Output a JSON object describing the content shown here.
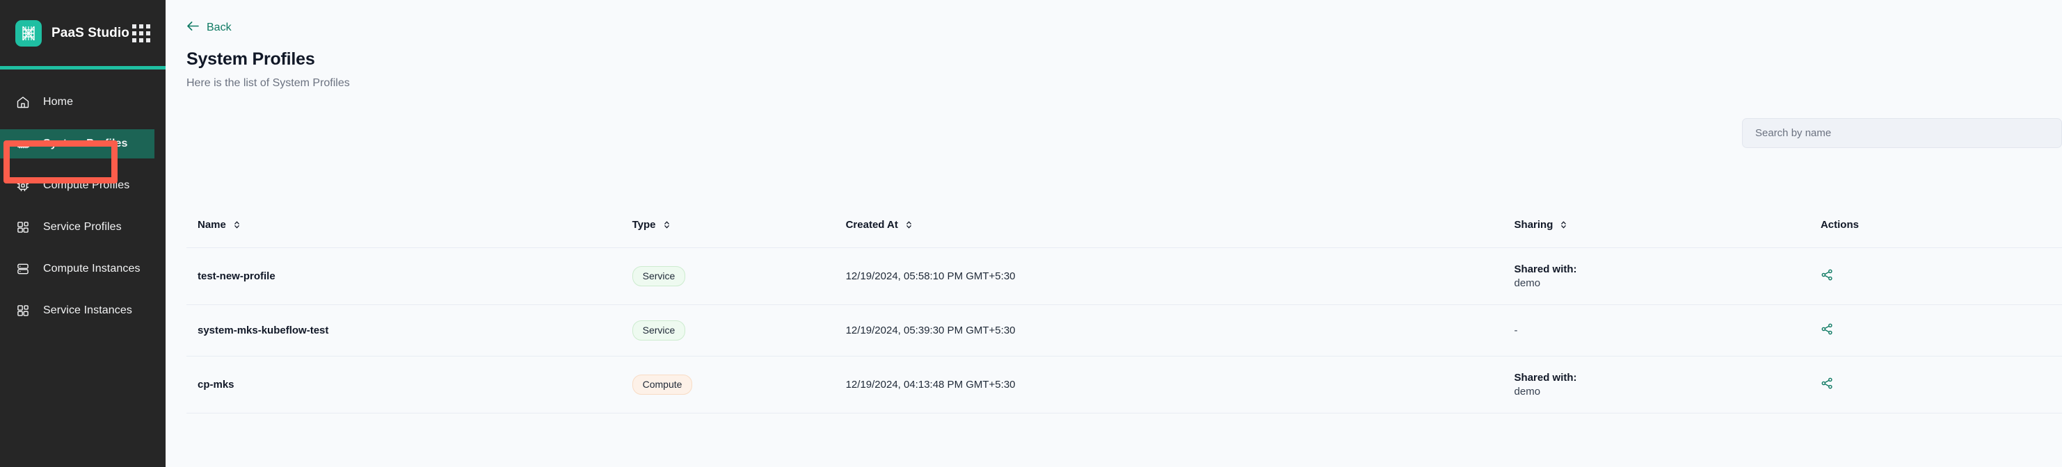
{
  "brand": {
    "name": "PaaS Studio",
    "logo_icon": "paas-studio-logo",
    "apps_icon": "apps-grid-icon",
    "accent": "#1fbfa2"
  },
  "sidebar": {
    "items": [
      {
        "label": "Home",
        "icon": "home-icon",
        "key": "home",
        "active": false
      },
      {
        "label": "System Profiles",
        "icon": "memory-chip-icon",
        "key": "system-profiles",
        "active": true
      },
      {
        "label": "Compute Profiles",
        "icon": "cpu-icon",
        "key": "compute-profiles",
        "active": false
      },
      {
        "label": "Service Profiles",
        "icon": "blocks-icon",
        "key": "service-profiles",
        "active": false
      },
      {
        "label": "Compute Instances",
        "icon": "server-icon",
        "key": "compute-instances",
        "active": false
      },
      {
        "label": "Service Instances",
        "icon": "blocks-icon",
        "key": "service-instances",
        "active": false
      }
    ],
    "active_bg": "#1c6455",
    "bg": "#262626"
  },
  "annotation": {
    "color": "#fc5d4b",
    "target": "sidebar-item-system-profiles"
  },
  "header": {
    "back_label": "Back",
    "back_icon": "arrow-left-icon",
    "title": "System Profiles",
    "subtitle": "Here is the list of System Profiles",
    "accent": "#0f7a63"
  },
  "search": {
    "placeholder": "Search by name",
    "value": ""
  },
  "table": {
    "columns": [
      {
        "label": "Name",
        "sortable": true,
        "key": "name"
      },
      {
        "label": "Type",
        "sortable": true,
        "key": "type"
      },
      {
        "label": "Created At",
        "sortable": true,
        "key": "created"
      },
      {
        "label": "Sharing",
        "sortable": true,
        "key": "sharing"
      },
      {
        "label": "Actions",
        "sortable": false,
        "key": "actions"
      }
    ],
    "rows": [
      {
        "name": "test-new-profile",
        "type": "Service",
        "type_variant": "service",
        "created_at": "12/19/2024, 05:58:10 PM GMT+5:30",
        "sharing_title": "Shared with:",
        "sharing_value": "demo",
        "action_icon": "share-icon"
      },
      {
        "name": "system-mks-kubeflow-test",
        "type": "Service",
        "type_variant": "service",
        "created_at": "12/19/2024, 05:39:30 PM GMT+5:30",
        "sharing_title": "",
        "sharing_value": "-",
        "action_icon": "share-icon"
      },
      {
        "name": "cp-mks",
        "type": "Compute",
        "type_variant": "compute",
        "created_at": "12/19/2024, 04:13:48 PM GMT+5:30",
        "sharing_title": "Shared with:",
        "sharing_value": "demo",
        "action_icon": "share-icon"
      }
    ]
  }
}
